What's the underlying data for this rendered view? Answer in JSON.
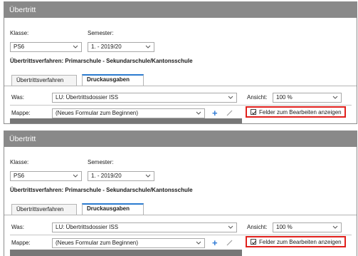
{
  "panels": [
    {
      "title": "Übertritt",
      "klasse_label": "Klasse:",
      "semester_label": "Semester:",
      "klasse_value": "PS6",
      "semester_value": "1. - 2019/20",
      "verfahren_text": "Übertrittsverfahren: Primarschule - Sekundarschule/Kantonsschule",
      "tabs": [
        {
          "label": "Übertrittsverfahren"
        },
        {
          "label": "Druckausgaben"
        }
      ],
      "was_label": "Was:",
      "was_value": "LU: Übertrittsdossier ISS",
      "ansicht_label": "Ansicht:",
      "ansicht_value": "100 %",
      "mappe_label": "Mappe:",
      "mappe_value": "(Neues Formular zum Beginnen)",
      "plus_glyph": "+",
      "checkbox_label": "Felder zum Bearbeiten anzeigen",
      "checkbox_checked": true
    },
    {
      "title": "Übertritt",
      "klasse_label": "Klasse:",
      "semester_label": "Semester:",
      "klasse_value": "PS6",
      "semester_value": "1. - 2019/20",
      "verfahren_text": "Übertrittsverfahren: Primarschule - Sekundarschule/Kantonsschule",
      "tabs": [
        {
          "label": "Übertrittsverfahren"
        },
        {
          "label": "Druckausgaben"
        }
      ],
      "was_label": "Was:",
      "was_value": "LU: Übertrittsdossier ISS",
      "ansicht_label": "Ansicht:",
      "ansicht_value": "100 %",
      "mappe_label": "Mappe:",
      "mappe_value": "(Neues Formular zum Beginnen)",
      "plus_glyph": "+",
      "checkbox_label": "Felder zum Bearbeiten anzeigen",
      "checkbox_checked": true
    }
  ],
  "colors": {
    "titlebar": "#898989",
    "highlight": "#e0201c",
    "accent": "#2b7bd0",
    "plus": "#2f7bd6"
  }
}
